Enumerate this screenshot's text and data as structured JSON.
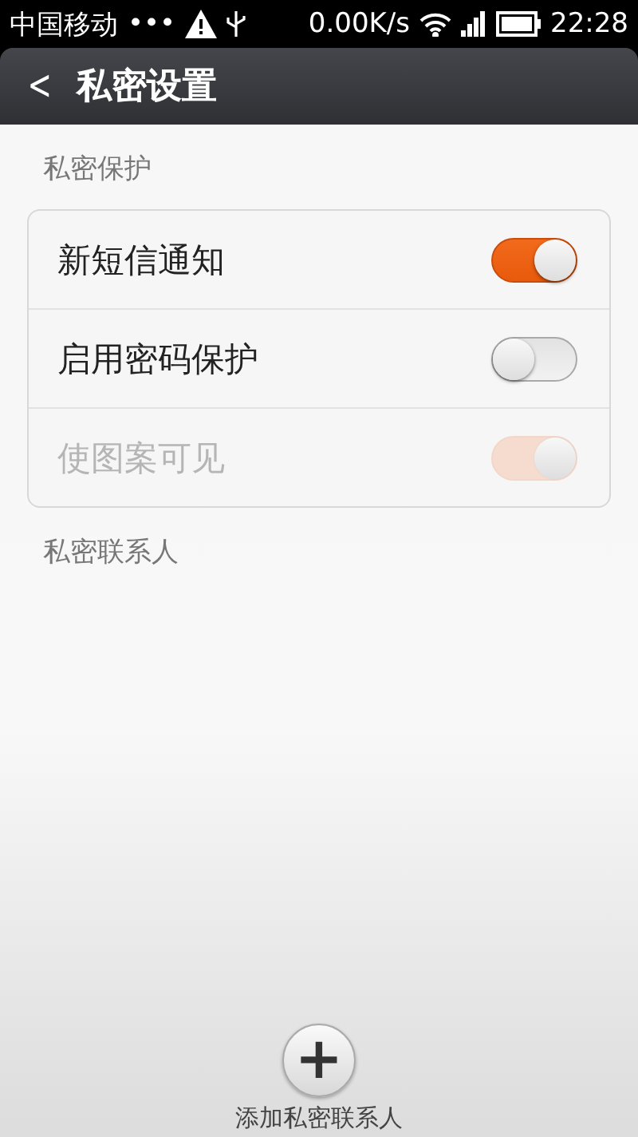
{
  "status_bar": {
    "carrier": "中国移动",
    "dots": "•••",
    "speed": "0.00K/s",
    "time": "22:28"
  },
  "header": {
    "back": "<",
    "title": "私密设置"
  },
  "sections": [
    {
      "title": "私密保护",
      "items": [
        {
          "label": "新短信通知",
          "on": true,
          "disabled": false
        },
        {
          "label": "启用密码保护",
          "on": false,
          "disabled": false
        },
        {
          "label": "使图案可见",
          "on": true,
          "disabled": true
        }
      ]
    },
    {
      "title": "私密联系人"
    }
  ],
  "add_button": {
    "icon": "+",
    "label": "添加私密联系人"
  }
}
